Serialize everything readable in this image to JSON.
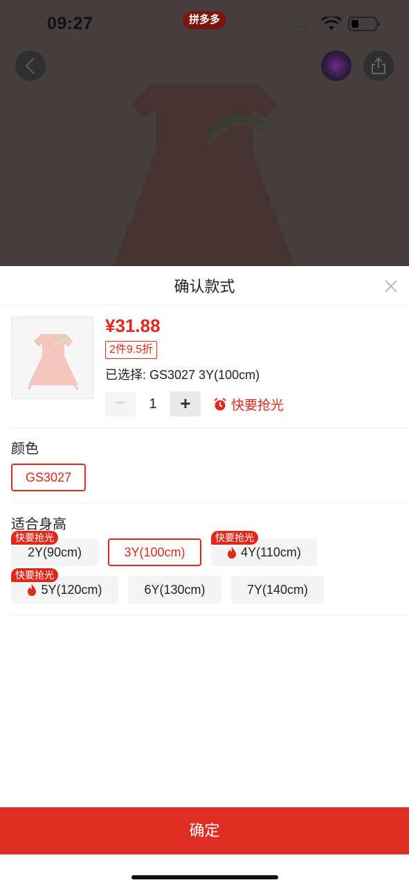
{
  "status_bar": {
    "time": "09:27",
    "app_badge": "拼多多"
  },
  "background_page": {
    "back_icon": "chevron-left-icon",
    "share_icon": "share-icon"
  },
  "sheet": {
    "title": "确认款式",
    "close_icon": "close-icon",
    "product": {
      "price": "¥31.88",
      "discount_tag": "2件9.5折",
      "selected_text": "已选择: GS3027 3Y(100cm)",
      "quantity": "1",
      "minus_label": "−",
      "plus_label": "+",
      "stock_note": "快要抢光"
    },
    "color_section": {
      "label": "颜色",
      "options": [
        "GS3027"
      ]
    },
    "size_section": {
      "label": "适合身高",
      "options": [
        {
          "label": "2Y(90cm)",
          "tag": "快要抢光",
          "flame": false,
          "selected": false
        },
        {
          "label": "3Y(100cm)",
          "tag": "",
          "flame": false,
          "selected": true
        },
        {
          "label": "4Y(110cm)",
          "tag": "快要抢光",
          "flame": true,
          "selected": false
        },
        {
          "label": "5Y(120cm)",
          "tag": "快要抢光",
          "flame": true,
          "selected": false
        },
        {
          "label": "6Y(130cm)",
          "tag": "",
          "flame": false,
          "selected": false
        },
        {
          "label": "7Y(140cm)",
          "tag": "",
          "flame": false,
          "selected": false
        }
      ]
    },
    "confirm_label": "确定"
  },
  "colors": {
    "accent": "#e0291c",
    "confirm_bg": "#e02e24"
  }
}
